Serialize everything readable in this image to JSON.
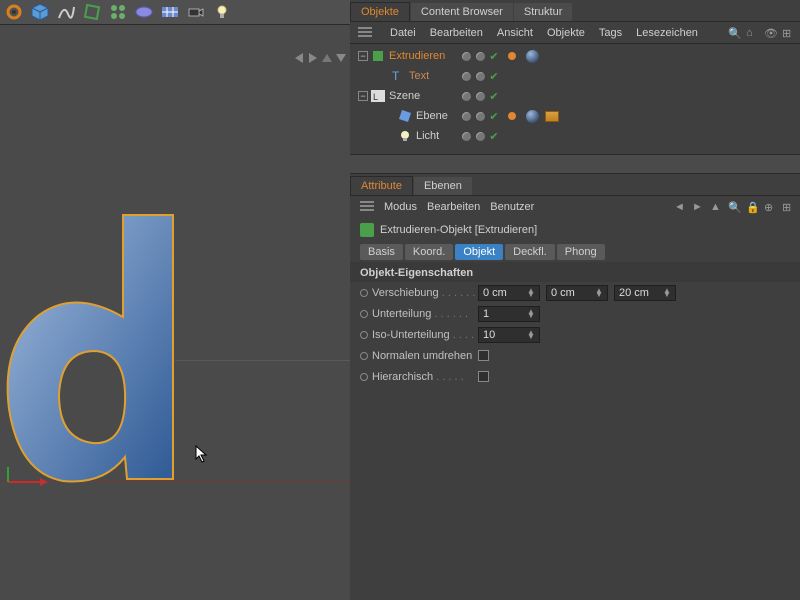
{
  "toolbar_icons": [
    "gear",
    "cube",
    "spline",
    "polygon",
    "cloner",
    "metaball",
    "grid-plane",
    "camera",
    "light"
  ],
  "tabs": {
    "objects": "Objekte",
    "content": "Content Browser",
    "structure": "Struktur"
  },
  "menu": {
    "file": "Datei",
    "edit": "Bearbeiten",
    "view": "Ansicht",
    "objects": "Objekte",
    "tags": "Tags",
    "bookmarks": "Lesezeichen"
  },
  "tree": {
    "extrude": "Extrudieren",
    "text": "Text",
    "scene": "Szene",
    "plane": "Ebene",
    "light": "Licht",
    "layer": "L 0"
  },
  "attr": {
    "tabs": {
      "attribute": "Attribute",
      "layers": "Ebenen"
    },
    "menu": {
      "mode": "Modus",
      "edit": "Bearbeiten",
      "user": "Benutzer"
    },
    "object_label": "Extrudieren-Objekt [Extrudieren]",
    "subtabs": {
      "base": "Basis",
      "coord": "Koord.",
      "object": "Objekt",
      "caps": "Deckfl.",
      "phong": "Phong"
    },
    "section": "Objekt-Eigenschaften",
    "props": {
      "movement_label": "Verschiebung",
      "movement_vals": [
        "0 cm",
        "0 cm",
        "20 cm"
      ],
      "subdiv_label": "Unterteilung",
      "subdiv_val": "1",
      "iso_label": "Iso-Unterteilung",
      "iso_val": "10",
      "flip_label": "Normalen umdrehen",
      "hier_label": "Hierarchisch"
    },
    "dots4": " . . . . . .",
    "dots3": " . . . . .",
    "dots2": " . . . ."
  },
  "viewport": {
    "letter": "d"
  }
}
